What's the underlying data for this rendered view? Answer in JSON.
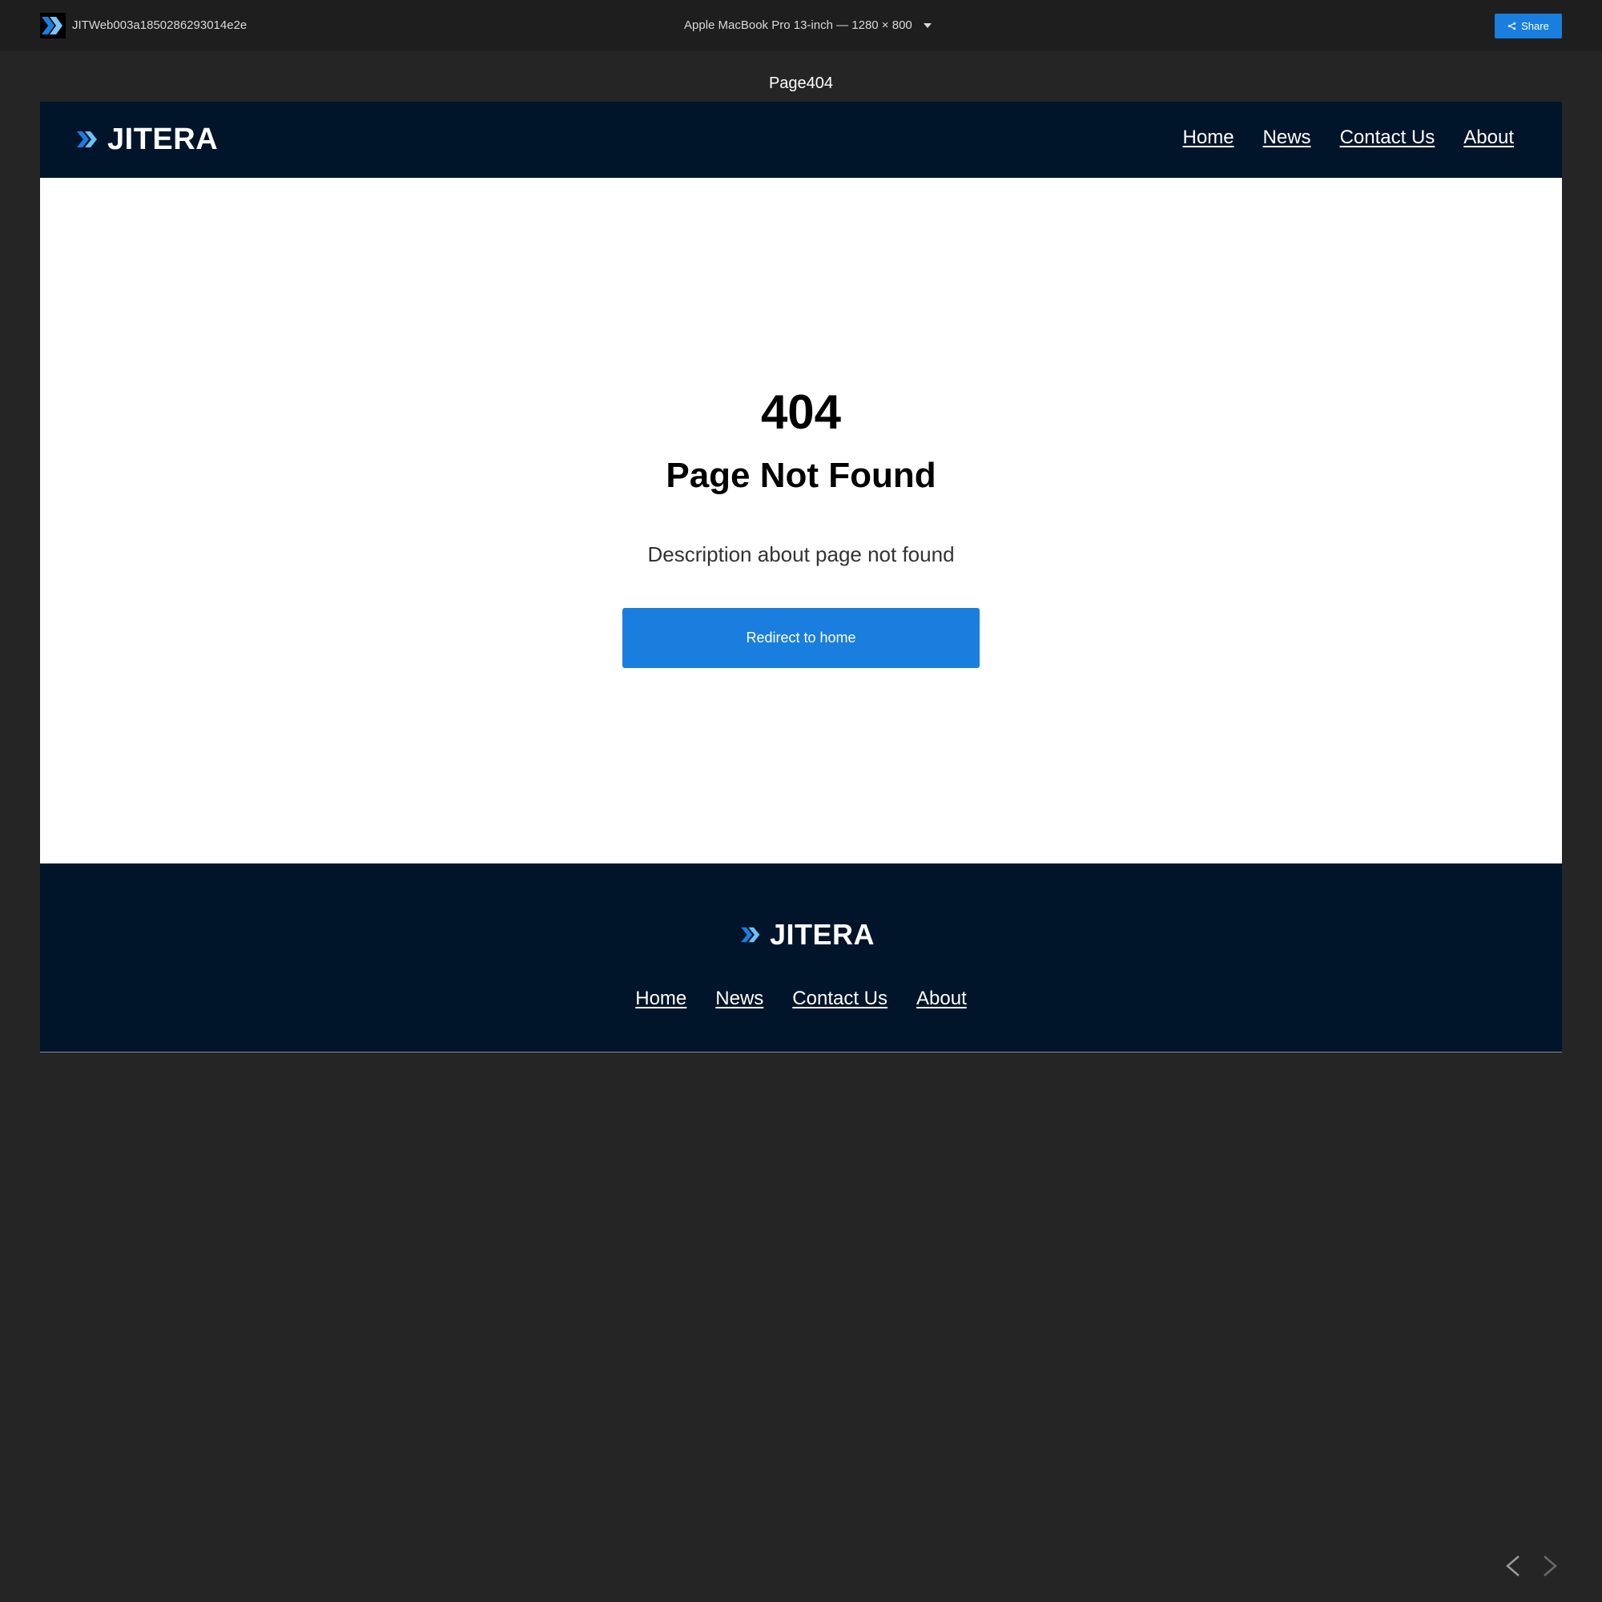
{
  "app": {
    "project_name": "JITWeb003a1850286293014e2e",
    "device_label": "Apple MacBook Pro 13-inch — 1280 × 800",
    "share_label": "Share",
    "page_name": "Page404"
  },
  "site": {
    "brand_name": "JITERA",
    "nav": [
      "Home",
      "News",
      "Contact Us",
      "About"
    ]
  },
  "error": {
    "code": "404",
    "title": "Page Not Found",
    "description": "Description about page not found",
    "button_label": "Redirect to home"
  },
  "footer": {
    "brand_name": "JITERA",
    "nav": [
      "Home",
      "News",
      "Contact Us",
      "About"
    ]
  },
  "colors": {
    "accent": "#1a7edf",
    "header_bg": "#00142a",
    "chrome_bg": "#1e1e1e",
    "workspace_bg": "#252525"
  },
  "icons": {
    "app_logo": "double-chevron-logo-icon",
    "device_dropdown": "caret-down-icon",
    "share": "share-icon",
    "prev": "chevron-left-icon",
    "next": "chevron-right-icon"
  }
}
